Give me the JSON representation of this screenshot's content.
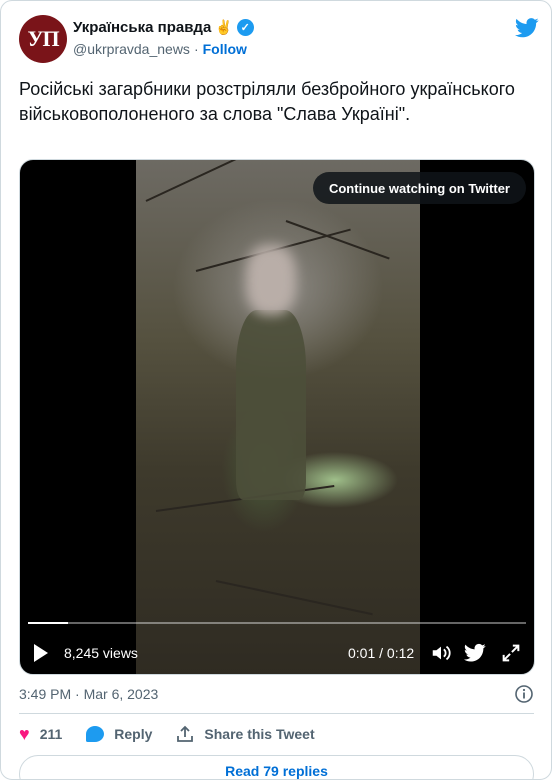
{
  "account": {
    "avatar_text": "УП",
    "display_name": "Українська правда",
    "emoji": "✌",
    "verified_mark": "✓",
    "handle": "@ukrpravda_news",
    "separator": "·",
    "follow_label": "Follow"
  },
  "tweet": {
    "text": "Російські загарбники розстріляли безбройного українського військовополоненого за слова \"Слава Україні\"."
  },
  "video": {
    "continue_label": "Continue watching on Twitter",
    "views": "8,245 views",
    "time": "0:01 / 0:12",
    "progress": 0.08
  },
  "meta": {
    "timestamp": "3:49 PM · Mar 6, 2023"
  },
  "actions": {
    "likes_count": "211",
    "reply_label": "Reply",
    "share_label": "Share this Tweet"
  },
  "footer": {
    "read_replies_label": "Read 79 replies"
  },
  "colors": {
    "twitter_blue": "#1d9bf0",
    "link_blue": "#006fd6",
    "heart_pink": "#f91880",
    "avatar_red": "#7a1419"
  },
  "icons": [
    "verified-badge-icon",
    "twitter-bird-icon",
    "play-icon",
    "volume-icon",
    "twitter-logo-icon",
    "fullscreen-icon",
    "info-icon",
    "heart-icon",
    "reply-icon",
    "share-icon"
  ]
}
